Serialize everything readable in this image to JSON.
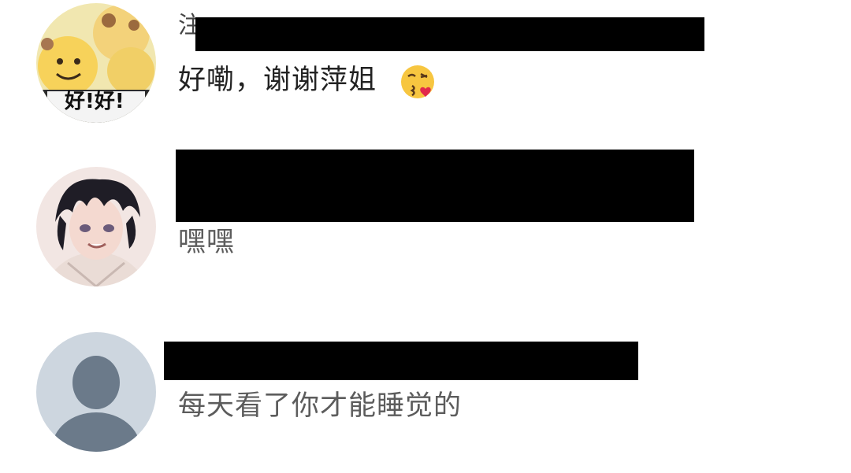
{
  "comments": [
    {
      "avatar": "cartoon-smiley-avatar",
      "avatar_text": "好!好!",
      "username_peek": "注",
      "message": "好嘞，谢谢萍姐",
      "emoji": "kissing-heart-emoji"
    },
    {
      "avatar": "anime-boy-avatar",
      "message": "嘿嘿"
    },
    {
      "avatar": "default-user-avatar",
      "message": "每天看了你才能睡觉的"
    }
  ],
  "colors": {
    "message_primary": "#222222",
    "message_secondary": "#5c5c5c",
    "redaction": "#000000",
    "default_avatar_bg": "#cdd6df",
    "default_avatar_fg": "#6b7a8a"
  }
}
